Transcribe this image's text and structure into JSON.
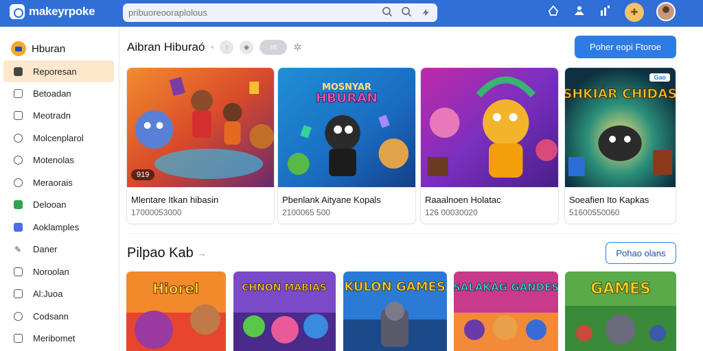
{
  "app": {
    "logo_text": "makeyrpoke"
  },
  "search": {
    "placeholder": "pribuoreooraplolous"
  },
  "sidebar": {
    "header": "Hburan",
    "items": [
      {
        "label": "Reporesan",
        "icon": "dashboard-icon",
        "active": true
      },
      {
        "label": "Betoadan",
        "icon": "folder-icon"
      },
      {
        "label": "Meotradn",
        "icon": "document-icon"
      },
      {
        "label": "Molcenplarol",
        "icon": "location-icon"
      },
      {
        "label": "Motenolas",
        "icon": "settings-icon"
      },
      {
        "label": "Meraorais",
        "icon": "circle-icon"
      },
      {
        "label": "Delooan",
        "icon": "green-square-icon"
      },
      {
        "label": "Aoklamples",
        "icon": "blue-square-icon"
      },
      {
        "label": "Daner",
        "icon": "edit-icon"
      },
      {
        "label": "Noroolan",
        "icon": "grid-icon"
      },
      {
        "label": "Al:Juoa",
        "icon": "chart-icon"
      },
      {
        "label": "Codsann",
        "icon": "clock-icon"
      },
      {
        "label": "Meribomet",
        "icon": "calendar-icon"
      }
    ]
  },
  "section1": {
    "title": "Aibran Hiburaó",
    "pill": "ııt",
    "button": "Poher eopi Ftoroe",
    "cards": [
      {
        "title": "Mlentare Itkan hibasin",
        "meta": "17000053000",
        "overlay": "919",
        "badge_left": ""
      },
      {
        "title": "Pbenlank Aityane Kopals",
        "meta": "2100065 500",
        "art_text": "HBURAN",
        "art_sub": "MOSNYAR"
      },
      {
        "title": "Raaalnoen Holatac",
        "meta": "126 00030020",
        "badge_left": ""
      },
      {
        "title": "Soeafien Ito Kapkas",
        "meta": "51600550060",
        "art_text": "SHKIÁR CHIDAS",
        "badge_right": "Gao"
      }
    ]
  },
  "section2": {
    "title": "Pilpao Kab",
    "arrow": "→",
    "button": "Pohao olans",
    "tiles": [
      {
        "art_text": "Hiorel"
      },
      {
        "art_text": "CHNON MABIAS"
      },
      {
        "art_text": "KULON GAMES"
      },
      {
        "art_text": "SALAKAG GANDES"
      },
      {
        "art_text": "GAMES"
      }
    ]
  },
  "colors": {
    "topbar": "#2f6fd6",
    "accent": "#2f7be5",
    "active_bg": "#fde8cc"
  }
}
